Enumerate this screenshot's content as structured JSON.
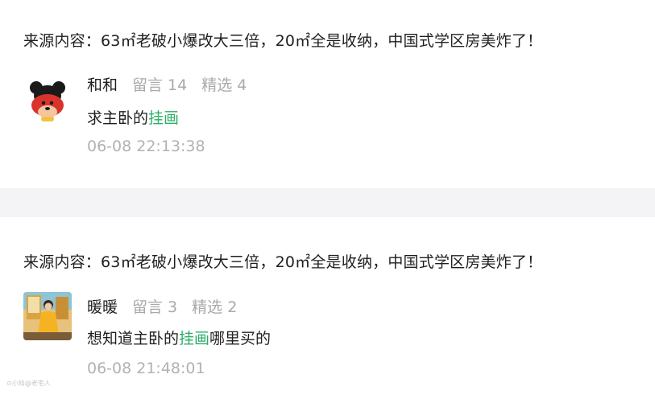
{
  "comments": [
    {
      "source_text": "来源内容：63㎡老破小爆改大三倍，20㎡全是收纳，中国式学区房美炸了！",
      "user_name": "和和",
      "messages_label": "留言 14",
      "featured_label": "精选 4",
      "comment_before": "求主卧的",
      "comment_highlight": "挂画",
      "comment_after": "",
      "timestamp": "06-08 22:13:38",
      "avatar_icon": "cartoon-mouse-avatar"
    },
    {
      "source_text": "来源内容：63㎡老破小爆改大三倍，20㎡全是收纳，中国式学区房美炸了！",
      "user_name": "暖暖",
      "messages_label": "留言 3",
      "featured_label": "精选 2",
      "comment_before": "想知道主卧的",
      "comment_highlight": "挂画",
      "comment_after": "哪里买的",
      "timestamp": "06-08 21:48:01",
      "avatar_icon": "illustrated-girl-avatar"
    }
  ],
  "watermark_text": "⊙小知@老宅人",
  "colors": {
    "highlight": "#2aae67",
    "muted": "#a9a9a9",
    "separator": "#f4f4f6"
  }
}
